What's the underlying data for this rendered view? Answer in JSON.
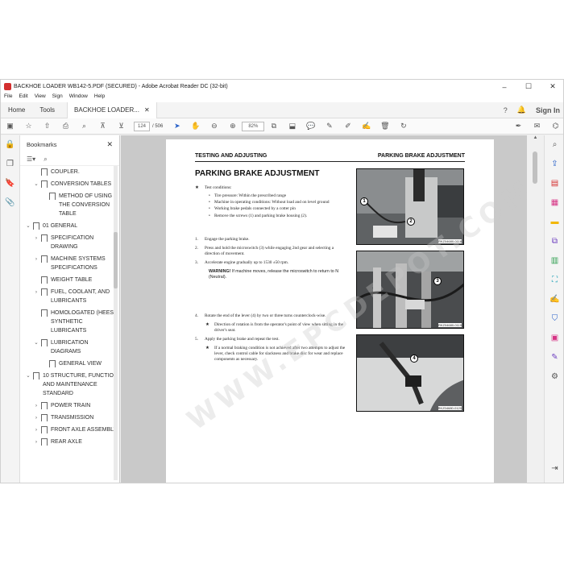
{
  "window": {
    "title": "BACKHOE LOADER WB142-5.PDF (SECURED) - Adobe Acrobat Reader DC (32-bit)",
    "minimize": "–",
    "maximize": "☐",
    "close": "✕"
  },
  "menu": [
    "File",
    "Edit",
    "View",
    "Sign",
    "Window",
    "Help"
  ],
  "tabs": {
    "home": "Home",
    "tools": "Tools",
    "doc": "BACKHOE LOADER...",
    "doc_close": "✕",
    "sign_in": "Sign In"
  },
  "toolbar": {
    "page_current": "124",
    "page_total": "/ 506",
    "zoom": "82%"
  },
  "bookmarks": {
    "title": "Bookmarks",
    "close": "✕",
    "items": [
      {
        "level": 1,
        "chev": "",
        "label": "COUPLER."
      },
      {
        "level": 1,
        "chev": "⌄",
        "label": "CONVERSION TABLES"
      },
      {
        "level": 2,
        "chev": "",
        "label": "METHOD OF USING THE CONVERSION TABLE"
      },
      {
        "level": 0,
        "chev": "⌄",
        "label": "01 GENERAL"
      },
      {
        "level": 1,
        "chev": "›",
        "label": "SPECIFICATION DRAWING"
      },
      {
        "level": 1,
        "chev": "›",
        "label": "MACHINE SYSTEMS SPECIFICATIONS"
      },
      {
        "level": 1,
        "chev": "",
        "label": "WEIGHT TABLE"
      },
      {
        "level": 1,
        "chev": "›",
        "label": "FUEL, COOLANT, AND LUBRICANTS"
      },
      {
        "level": 1,
        "chev": "",
        "label": "HOMOLOGATED (HEES) SYNTHETIC LUBRICANTS"
      },
      {
        "level": 1,
        "chev": "⌄",
        "label": "LUBRICATION DIAGRAMS"
      },
      {
        "level": 2,
        "chev": "",
        "label": "GENERAL VIEW"
      },
      {
        "level": 0,
        "chev": "⌄",
        "label": "10 STRUCTURE, FUNCTION AND MAINTENANCE STANDARD"
      },
      {
        "level": 1,
        "chev": "›",
        "label": "POWER TRAIN"
      },
      {
        "level": 1,
        "chev": "›",
        "label": "TRANSMISSION"
      },
      {
        "level": 1,
        "chev": "›",
        "label": "FRONT AXLE ASSEMBLY"
      },
      {
        "level": 1,
        "chev": "›",
        "label": "REAR AXLE"
      }
    ]
  },
  "page": {
    "header_left": "TESTING AND ADJUSTING",
    "header_right": "PARKING BRAKE ADJUSTMENT",
    "title": "PARKING BRAKE ADJUSTMENT",
    "conditions_title": "Test conditions:",
    "conditions": [
      "Tire pressure: Within the prescribed range",
      "Machine in operating conditions: Without load and on level ground",
      "Working brake pedals connected by a cotter pin",
      "Remove the screws (1) and parking brake housing (2)."
    ],
    "steps": [
      {
        "n": "1.",
        "text": "Engage the parking brake."
      },
      {
        "n": "2.",
        "text": "Press and hold the microswitch (3) while engaging 2nd gear and selecting a direction of movement."
      },
      {
        "n": "3.",
        "text": "Accelerate engine gradually up to 1530 ±50 rpm."
      }
    ],
    "warning_label": "WARNING!",
    "warning_text": "If machine moves, release the microswitch to return to N (Neutral).",
    "step4": {
      "n": "4.",
      "text": "Rotate the end of the lever (4) by two or three turns counterclock-wise."
    },
    "note4": "Direction of rotation is from the operator's point of view when sitting in the driver's seat.",
    "step5": {
      "n": "5.",
      "text": "Apply the parking brake and repeat the test."
    },
    "note5": "If a normal braking condition is not achieved after two attempts to adjust the lever, check control cable for slackness and brake disc for wear and replace components as necessary.",
    "photo_caps": [
      "RKZ04680-0118",
      "RKZ04680-0119",
      "RKZ04680-0120"
    ],
    "callouts": [
      "1",
      "2",
      "3",
      "4"
    ],
    "watermark": "WWW.EPCDEPOT.COM"
  }
}
